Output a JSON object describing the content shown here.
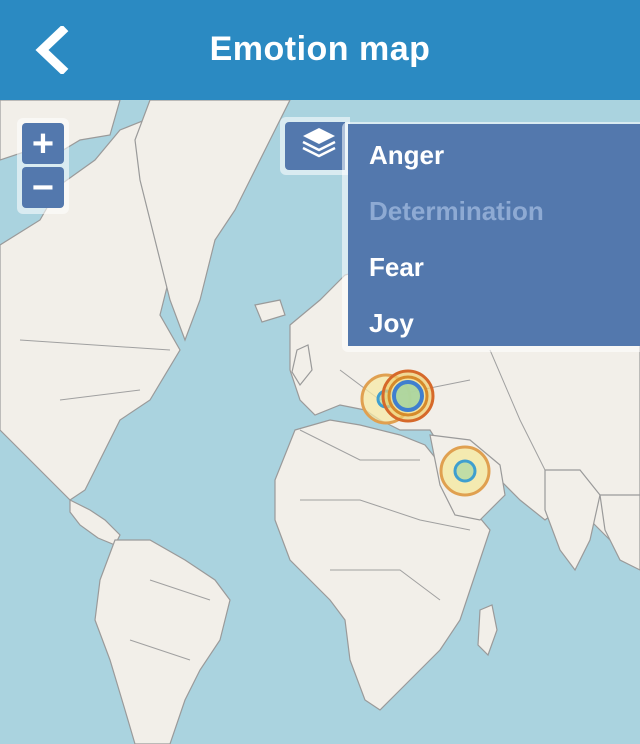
{
  "header": {
    "title": "Emotion map",
    "back_icon": "chevron-left-icon"
  },
  "zoom": {
    "in_label": "+",
    "out_label": "−"
  },
  "layers": {
    "icon": "layers-icon",
    "items": [
      {
        "label": "Anger",
        "active": true
      },
      {
        "label": "Determination",
        "active": false
      },
      {
        "label": "Fear",
        "active": true
      },
      {
        "label": "Joy",
        "active": true
      }
    ]
  },
  "colors": {
    "header": "#2b8ac2",
    "water": "#aad3df",
    "land": "#f2efe9",
    "border": "#8a8a8a",
    "control": "#5378ad",
    "inactive_text": "#8eaad3",
    "marker_yellow": "#f5e9a6",
    "marker_orange": "#d6692a",
    "marker_teal": "#3f9fcf"
  }
}
